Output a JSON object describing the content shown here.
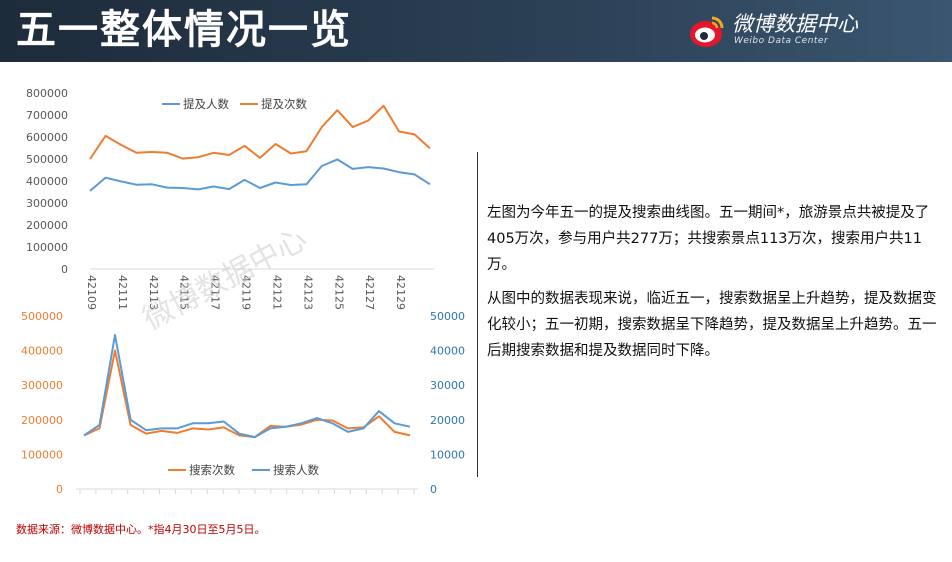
{
  "page": {
    "title": "五一整体情况一览"
  },
  "logo": {
    "name": "微博数据中心",
    "subtitle": "Weibo Data Center"
  },
  "watermark": "微博数据中心",
  "description": {
    "p1": "左图为今年五一的提及搜索曲线图。五一期间*，旅游景点共被提及了405万次，参与用户共277万；共搜索景点113万次，搜索用户共11万。",
    "p2": "从图中的数据表现来说，临近五一，搜索数据呈上升趋势，提及数据变化较小；五一初期，搜索数据呈下降趋势，提及数据呈上升趋势。五一后期搜索数据和提及数据同时下降。"
  },
  "footnote": "数据来源：微博数据中心。*指4月30日至5月5日。",
  "colors": {
    "blue": "#5b9bd5",
    "orange": "#ed7d31",
    "header": "#1d2b3a"
  },
  "chart_data": [
    {
      "type": "line",
      "x": [
        42109,
        42110,
        42111,
        42112,
        42113,
        42114,
        42115,
        42116,
        42117,
        42118,
        42119,
        42120,
        42121,
        42122,
        42123,
        42124,
        42125,
        42126,
        42127,
        42128,
        42129,
        42130,
        42131
      ],
      "x_tick_labels": [
        "42109",
        "42111",
        "42113",
        "42115",
        "42117",
        "42119",
        "42121",
        "42123",
        "42125",
        "42127",
        "42129"
      ],
      "y_ticks": [
        "0",
        "100000",
        "200000",
        "300000",
        "400000",
        "500000",
        "600000",
        "700000",
        "800000"
      ],
      "ylim": [
        0,
        800000
      ],
      "legend_position": "top",
      "series": [
        {
          "name": "提及人数",
          "color": "#5b9bd5",
          "values": [
            355000,
            415000,
            398000,
            383000,
            385000,
            370000,
            368000,
            362000,
            375000,
            363000,
            405000,
            368000,
            393000,
            382000,
            385000,
            468000,
            498000,
            455000,
            463000,
            457000,
            440000,
            430000,
            385000
          ]
        },
        {
          "name": "提及次数",
          "color": "#ed7d31",
          "values": [
            500000,
            605000,
            565000,
            528000,
            532000,
            528000,
            502000,
            508000,
            528000,
            518000,
            560000,
            505000,
            568000,
            525000,
            535000,
            645000,
            722000,
            645000,
            675000,
            742000,
            625000,
            612000,
            548000
          ]
        }
      ]
    },
    {
      "type": "line",
      "y_ticks_left": [
        "0",
        "100000",
        "200000",
        "300000",
        "400000",
        "500000"
      ],
      "ylim_left": [
        0,
        500000
      ],
      "y_ticks_right": [
        "0",
        "10000",
        "20000",
        "30000",
        "40000",
        "50000"
      ],
      "ylim_right": [
        0,
        50000
      ],
      "legend_position": "bottom",
      "series": [
        {
          "name": "搜索次数",
          "color": "#ed7d31",
          "axis": "left",
          "values": [
            155000,
            175000,
            400000,
            185000,
            160000,
            168000,
            162000,
            175000,
            172000,
            178000,
            155000,
            150000,
            182000,
            180000,
            186000,
            200000,
            198000,
            175000,
            178000,
            210000,
            165000,
            155000
          ]
        },
        {
          "name": "搜索人数",
          "color": "#5b9bd5",
          "axis": "right",
          "values": [
            15500,
            18500,
            44500,
            20000,
            17000,
            17500,
            17500,
            19000,
            19000,
            19500,
            16000,
            15000,
            17500,
            18000,
            19000,
            20500,
            19000,
            16500,
            17500,
            22500,
            19000,
            18000
          ]
        }
      ]
    }
  ]
}
